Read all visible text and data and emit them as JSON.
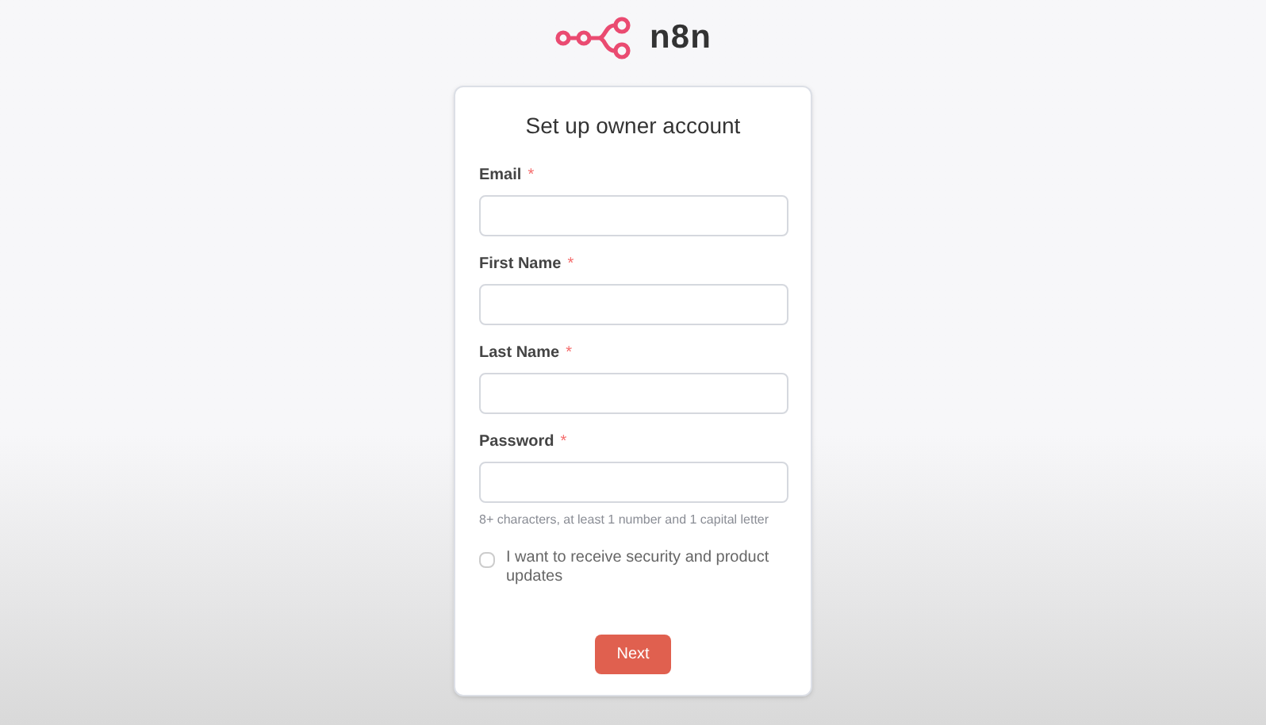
{
  "logo": {
    "text": "n8n"
  },
  "form": {
    "title": "Set up owner account",
    "fields": [
      {
        "label": "Email",
        "required_mark": "*"
      },
      {
        "label": "First Name",
        "required_mark": "*"
      },
      {
        "label": "Last Name",
        "required_mark": "*"
      },
      {
        "label": "Password",
        "required_mark": "*",
        "hint": "8+ characters, at least 1 number and 1 capital letter"
      }
    ],
    "checkbox": {
      "label": "I want to receive security and product updates",
      "checked": false
    },
    "submit": "Next"
  }
}
